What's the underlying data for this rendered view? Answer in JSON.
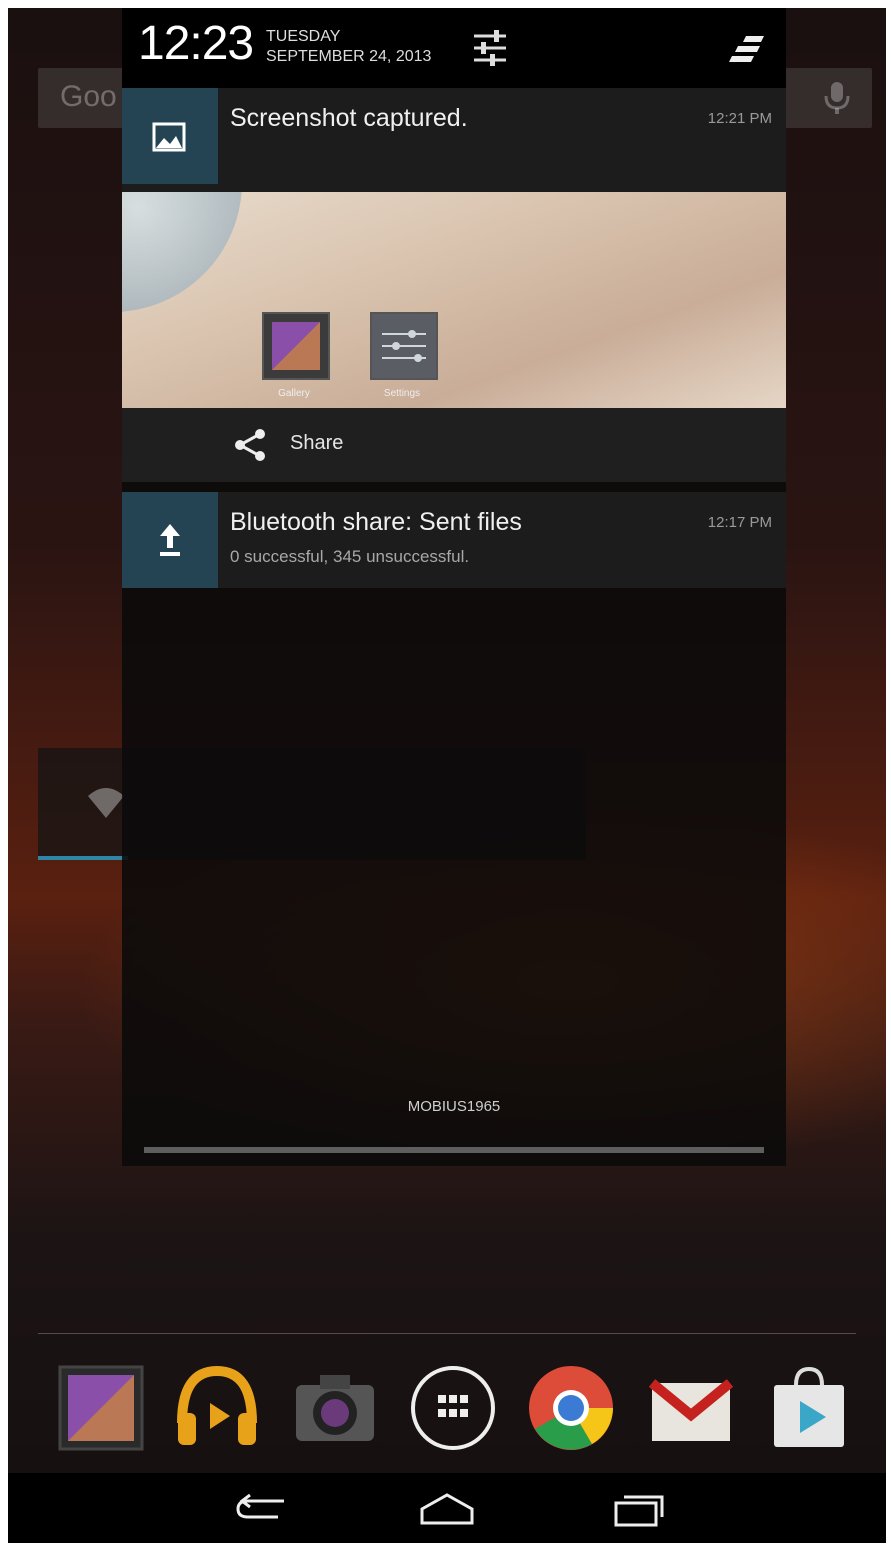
{
  "status_header": {
    "time": "12:23",
    "day": "TUESDAY",
    "date": "SEPTEMBER 24, 2013",
    "settings_icon": "quick-settings-icon",
    "clear_icon": "clear-notifications-icon"
  },
  "notifications": [
    {
      "title": "Screenshot captured.",
      "time": "12:21 PM",
      "icon": "image-icon",
      "preview": {
        "apps": [
          "Gallery",
          "Settings"
        ]
      },
      "action": {
        "label": "Share",
        "icon": "share-icon"
      }
    },
    {
      "title": "Bluetooth share: Sent files",
      "subtitle": "0 successful, 345 unsuccessful.",
      "time": "12:17 PM",
      "icon": "upload-icon"
    }
  ],
  "shade_footer": {
    "carrier": "MOBIUS1965"
  },
  "launcher": {
    "search_text": "Goo",
    "dock": [
      "gallery-icon",
      "play-music-icon",
      "camera-icon",
      "app-drawer-icon",
      "chrome-icon",
      "gmail-icon",
      "play-store-icon"
    ]
  },
  "nav": [
    "back-icon",
    "home-icon",
    "recents-icon"
  ],
  "colors": {
    "notif_icon_bg": "#244454",
    "accent": "#33b5e5"
  }
}
